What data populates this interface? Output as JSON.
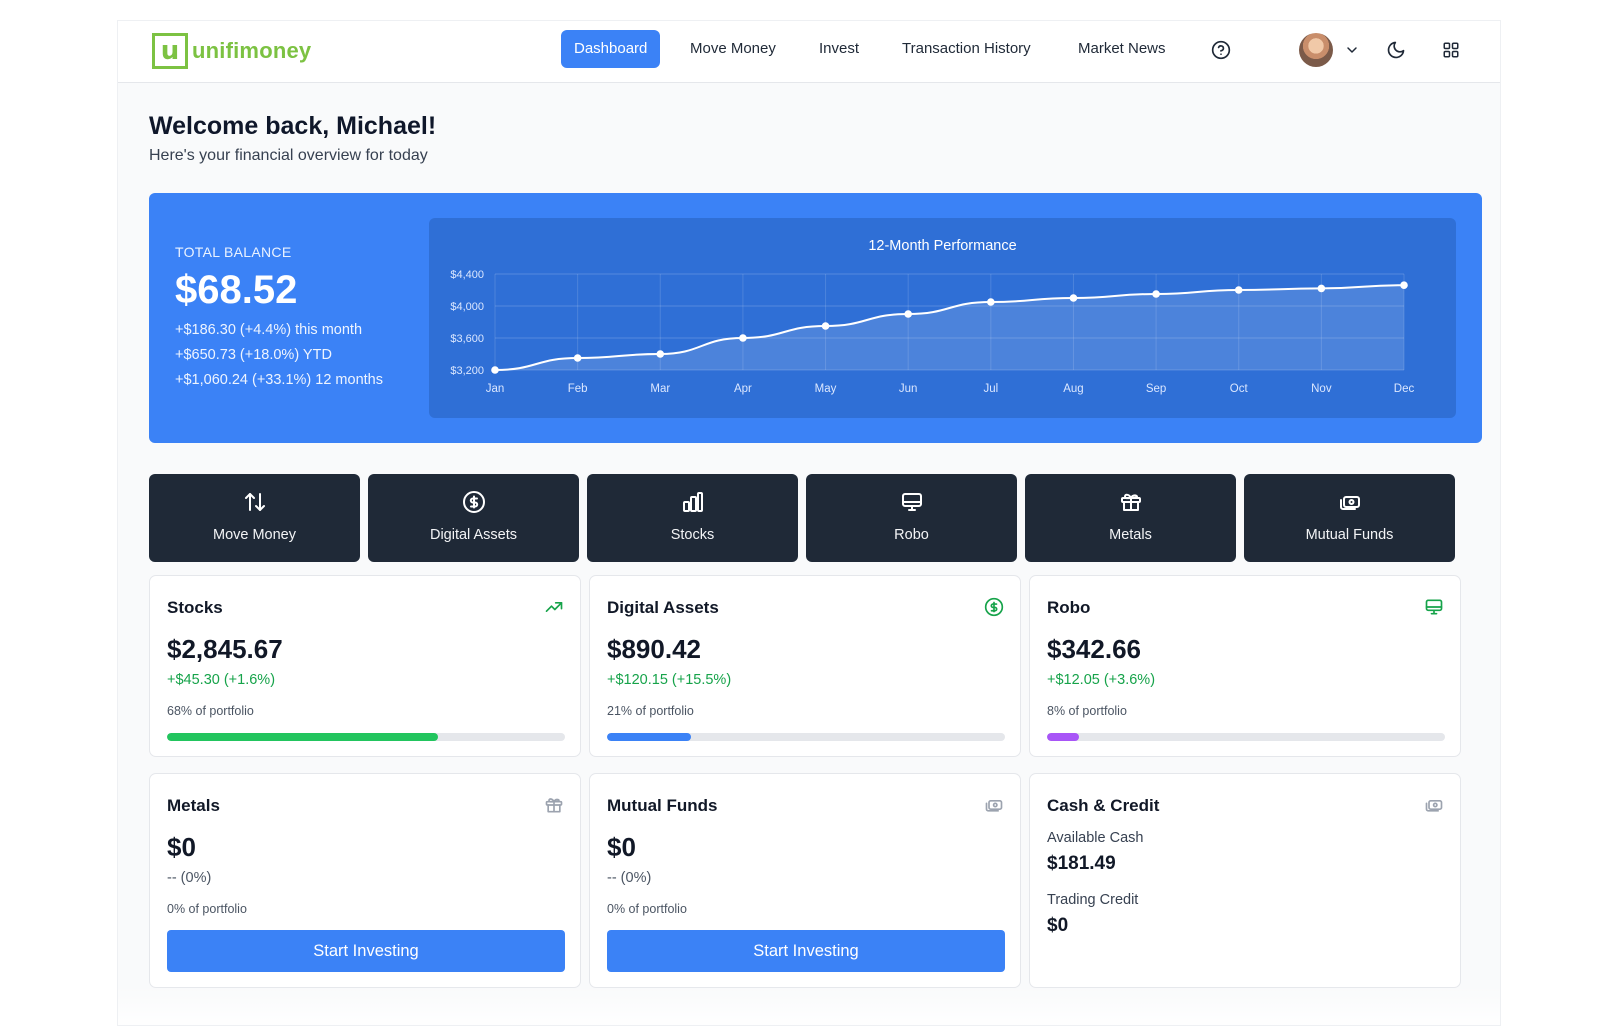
{
  "brand": {
    "mark": "u",
    "name": "unifimoney",
    "color": "#7cc242"
  },
  "nav": {
    "items": [
      {
        "label": "Dashboard",
        "active": true
      },
      {
        "label": "Move Money"
      },
      {
        "label": "Invest"
      },
      {
        "label": "Transaction History"
      },
      {
        "label": "Market News"
      }
    ],
    "icons": [
      "help-circle-icon",
      "avatar",
      "chevron-down-icon",
      "moon-icon",
      "grid-icon"
    ]
  },
  "header": {
    "title": "Welcome back, Michael!",
    "subtitle": "Here's your financial overview for today"
  },
  "balance": {
    "label": "TOTAL BALANCE",
    "amount": "$68.52",
    "month": "+$186.30 (+4.4%) this month",
    "ytd": "+$650.73 (+18.0%) YTD",
    "year": "+$1,060.24 (+33.1%) 12 months"
  },
  "chart_data": {
    "type": "area",
    "title": "12-Month Performance",
    "categories": [
      "Jan",
      "Feb",
      "Mar",
      "Apr",
      "May",
      "Jun",
      "Jul",
      "Aug",
      "Sep",
      "Oct",
      "Nov",
      "Dec"
    ],
    "series": [
      {
        "values": [
          3200,
          3350,
          3400,
          3600,
          3750,
          3900,
          4050,
          4100,
          4150,
          4200,
          4220,
          4260
        ]
      }
    ],
    "yticks": [
      "$4,400",
      "$4,000",
      "$3,600",
      "$3,200"
    ],
    "ytick_values": [
      4400,
      4000,
      3600,
      3200
    ],
    "ylim": [
      3200,
      4400
    ],
    "grid": true,
    "line_color": "#ffffff"
  },
  "actions": [
    {
      "label": "Move Money",
      "icon": "arrows-up-down-icon"
    },
    {
      "label": "Digital Assets",
      "icon": "dollar-circle-icon"
    },
    {
      "label": "Stocks",
      "icon": "bar-chart-icon"
    },
    {
      "label": "Robo",
      "icon": "monitor-icon"
    },
    {
      "label": "Metals",
      "icon": "gift-icon"
    },
    {
      "label": "Mutual Funds",
      "icon": "cash-icon"
    }
  ],
  "cards": {
    "stocks": {
      "title": "Stocks",
      "amount": "$2,845.67",
      "change": "+$45.30 (+1.6%)",
      "portfolio": "68% of portfolio",
      "portfolio_fraction": 0.68,
      "bar_color": "#22c55e",
      "icon": "trending-up-icon"
    },
    "digital": {
      "title": "Digital Assets",
      "amount": "$890.42",
      "change": "+$120.15 (+15.5%)",
      "portfolio": "21% of portfolio",
      "portfolio_fraction": 0.21,
      "bar_color": "#3b82f6",
      "icon": "dollar-circle-icon"
    },
    "robo": {
      "title": "Robo",
      "amount": "$342.66",
      "change": "+$12.05 (+3.6%)",
      "portfolio": "8% of portfolio",
      "portfolio_fraction": 0.08,
      "bar_color": "#a855f7",
      "icon": "monitor-icon"
    },
    "metals": {
      "title": "Metals",
      "amount": "$0",
      "change": "-- (0%)",
      "portfolio": "0% of portfolio",
      "cta": "Start Investing",
      "icon": "gift-icon"
    },
    "mutual": {
      "title": "Mutual Funds",
      "amount": "$0",
      "change": "-- (0%)",
      "portfolio": "0% of portfolio",
      "cta": "Start Investing",
      "icon": "cash-icon"
    },
    "cash": {
      "title": "Cash & Credit",
      "available_label": "Available Cash",
      "available_value": "$181.49",
      "credit_label": "Trading Credit",
      "credit_value": "$0",
      "icon": "cash-icon"
    }
  }
}
